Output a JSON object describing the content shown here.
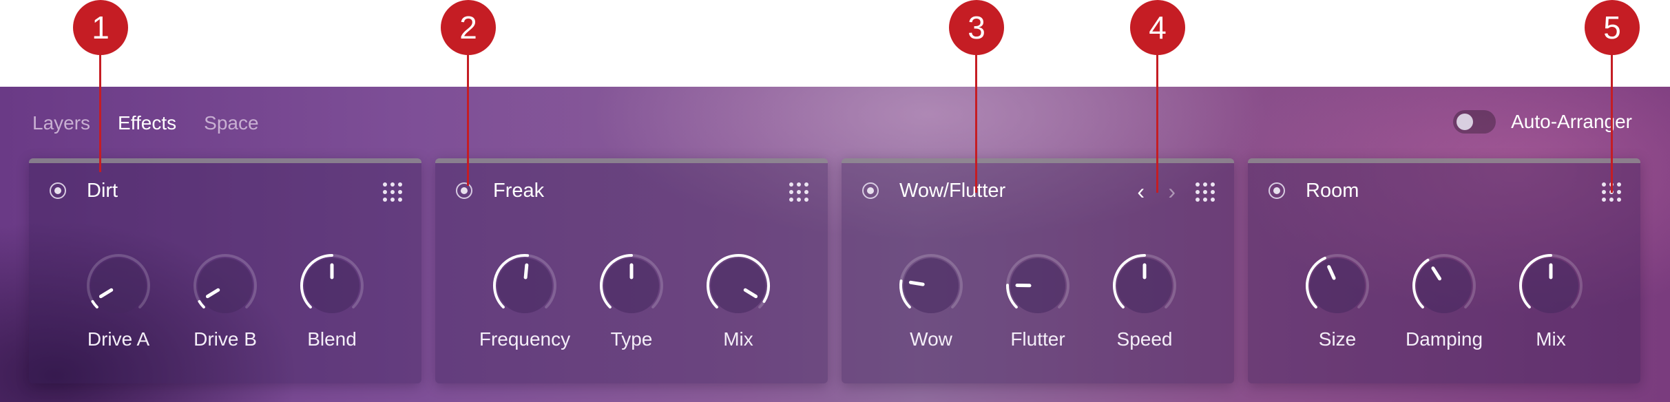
{
  "tabs": [
    "Layers",
    "Effects",
    "Space"
  ],
  "active_tab": "Effects",
  "auto_arranger": {
    "label": "Auto-Arranger",
    "enabled": false
  },
  "markers": [
    "1",
    "2",
    "3",
    "4",
    "5"
  ],
  "marker_color": "#c51d24",
  "panels": [
    {
      "title": "Dirt",
      "icon": "grid-icon",
      "knobs": [
        {
          "label": "Drive A",
          "value": 0.05
        },
        {
          "label": "Drive B",
          "value": 0.05
        },
        {
          "label": "Blend",
          "value": 0.5
        }
      ]
    },
    {
      "title": "Freak",
      "icon": "grid-icon",
      "knobs": [
        {
          "label": "Frequency",
          "value": 0.52
        },
        {
          "label": "Type",
          "value": 0.5
        },
        {
          "label": "Mix",
          "value": 0.95
        }
      ]
    },
    {
      "title": "Wow/Flutter",
      "icon": "grid-icon",
      "nav": [
        "chevron-left-icon",
        "chevron-right-icon"
      ],
      "knobs": [
        {
          "label": "Wow",
          "value": 0.2
        },
        {
          "label": "Flutter",
          "value": 0.17
        },
        {
          "label": "Speed",
          "value": 0.5
        }
      ]
    },
    {
      "title": "Room",
      "icon": "grid-icon",
      "knobs": [
        {
          "label": "Size",
          "value": 0.41
        },
        {
          "label": "Damping",
          "value": 0.38
        },
        {
          "label": "Mix",
          "value": 0.5
        }
      ]
    }
  ]
}
